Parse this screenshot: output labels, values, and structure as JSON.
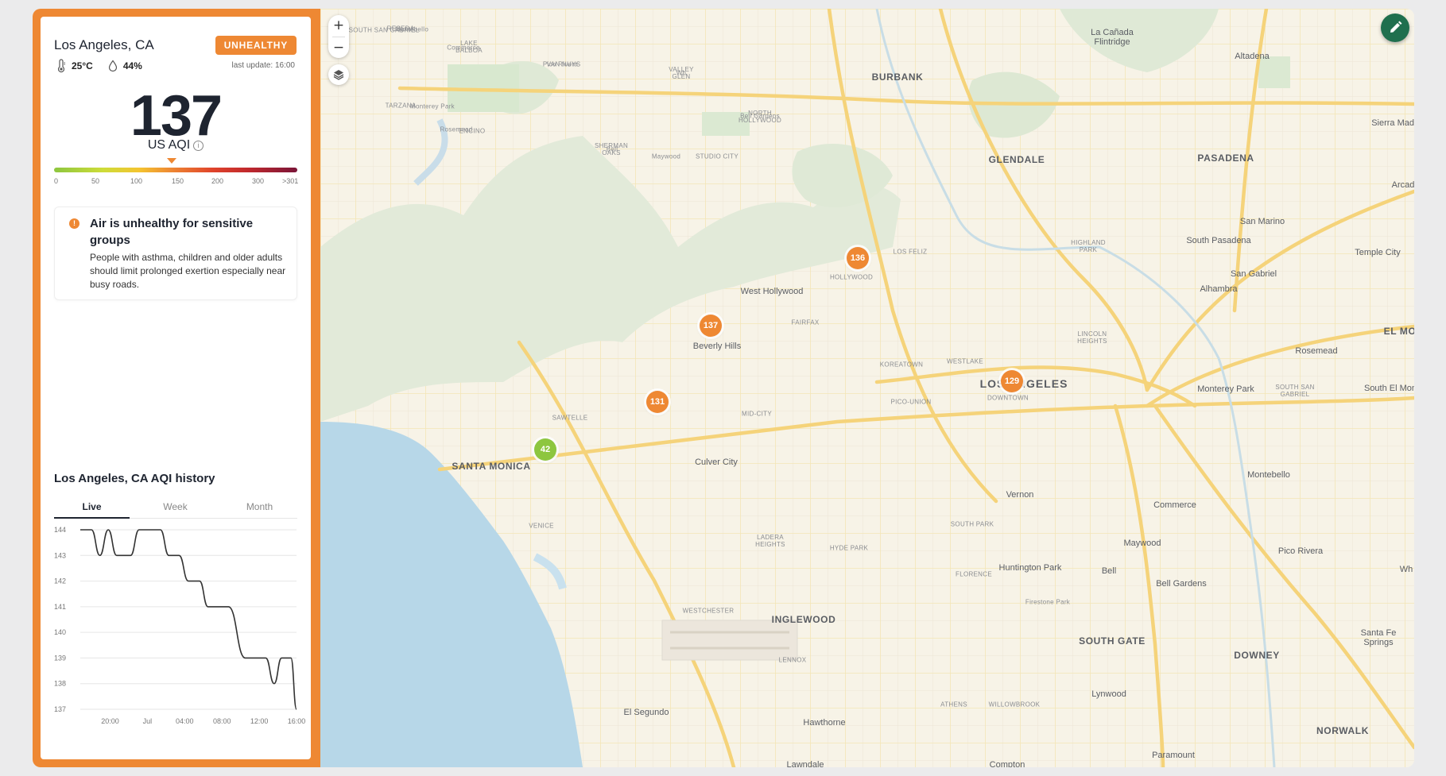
{
  "location": {
    "name": "Los Angeles, CA",
    "status": "UNHEALTHY",
    "temperature": "25°C",
    "humidity": "44%",
    "last_update": "last update: 16:00"
  },
  "aqi": {
    "value": "137",
    "label": "US AQI",
    "scale_labels": [
      "0",
      "50",
      "100",
      "150",
      "200",
      "300",
      ">301"
    ],
    "scale_colors": [
      "#8dc63f",
      "#cddc39",
      "#f4c430",
      "#ee8833",
      "#e0442b",
      "#c0282d",
      "#7a1538"
    ]
  },
  "alert": {
    "title": "Air is unhealthy for sensitive groups",
    "body": "People with asthma, children and older adults should limit prolonged exertion especially near busy roads.",
    "icon": "warning-icon"
  },
  "history": {
    "title": "Los Angeles, CA AQI history",
    "tabs": [
      "Live",
      "Week",
      "Month"
    ],
    "active_tab": "Live"
  },
  "chart_data": {
    "type": "line",
    "title": "Los Angeles, CA AQI history",
    "xlabel": "",
    "ylabel": "",
    "ylim": [
      137,
      144
    ],
    "y_ticks": [
      "144",
      "143",
      "142",
      "141",
      "140",
      "139",
      "138",
      "137"
    ],
    "x_ticks": [
      "20:00",
      "Jul",
      "04:00",
      "08:00",
      "12:00",
      "16:00"
    ],
    "x_tick_hours": [
      20,
      24,
      28,
      32,
      36,
      40
    ],
    "x_range_hours": [
      16.8,
      40
    ],
    "series": [
      {
        "color": "#333333",
        "points": [
          [
            16.8,
            144
          ],
          [
            18.0,
            144
          ],
          [
            18.9,
            143
          ],
          [
            19.8,
            144
          ],
          [
            20.7,
            143
          ],
          [
            22.2,
            143
          ],
          [
            23.1,
            144
          ],
          [
            25.4,
            144
          ],
          [
            26.3,
            143
          ],
          [
            27.4,
            143
          ],
          [
            28.4,
            142
          ],
          [
            29.6,
            142
          ],
          [
            30.5,
            141
          ],
          [
            32.7,
            141
          ],
          [
            34.5,
            139
          ],
          [
            36.7,
            139
          ],
          [
            37.6,
            138
          ],
          [
            38.4,
            139
          ],
          [
            39.4,
            139
          ],
          [
            40.0,
            137
          ]
        ]
      }
    ]
  },
  "map": {
    "stations": [
      {
        "value": "136",
        "color": "#ee8833"
      },
      {
        "value": "137",
        "color": "#ee8833"
      },
      {
        "value": "131",
        "color": "#ee8833"
      },
      {
        "value": "129",
        "color": "#ee8833"
      },
      {
        "value": "42",
        "color": "#8dc63f"
      }
    ],
    "places": [
      "BURBANK",
      "GLENDALE",
      "PASADENA",
      "La Cañada Flintridge",
      "Altadena",
      "Sierra Madre",
      "Arcad",
      "San Marino",
      "South Pasadena",
      "Temple City",
      "San Gabriel",
      "Alhambra",
      "EL MO",
      "Rosemead",
      "Monterey Park",
      "SOUTH SAN GABRIEL",
      "South El Mon",
      "Montebello",
      "Commerce",
      "Pico Rivera",
      "Wh",
      "Bell Gardens",
      "Maywood",
      "Bell",
      "Huntington Park",
      "Vernon",
      "Firestone Park",
      "SOUTH GATE",
      "DOWNEY",
      "Santa Fe Springs",
      "Lynwood",
      "NORWALK",
      "Paramount",
      "Compton",
      "Hawthorne",
      "Lawndale",
      "El Segundo",
      "INGLEWOOD",
      "LENNOX",
      "ATHENS",
      "WILLOWBROOK",
      "WESTCHESTER",
      "HYDE PARK",
      "FLORENCE",
      "SOUTH PARK",
      "LADERA HEIGHTS",
      "Culver City",
      "VENICE",
      "SANTA MONICA",
      "SAWTELLE",
      "MID-CITY",
      "PICO-UNION",
      "LOS ANGELES",
      "DOWNTOWN",
      "WESTLAKE",
      "KOREATOWN",
      "LINCOLN HEIGHTS",
      "HIGHLAND PARK",
      "LOS FELIZ",
      "HOLLYWOOD",
      "West Hollywood",
      "FAIRFAX",
      "Beverly Hills",
      "ENCINO",
      "TARZANA",
      "RESEDA",
      "LAKE BALBOA",
      "VAN NUYS",
      "VALLEY GLEN",
      "NORTH HOLLYWOOD",
      "STUDIO CITY",
      "SHERMAN OAKS"
    ]
  }
}
